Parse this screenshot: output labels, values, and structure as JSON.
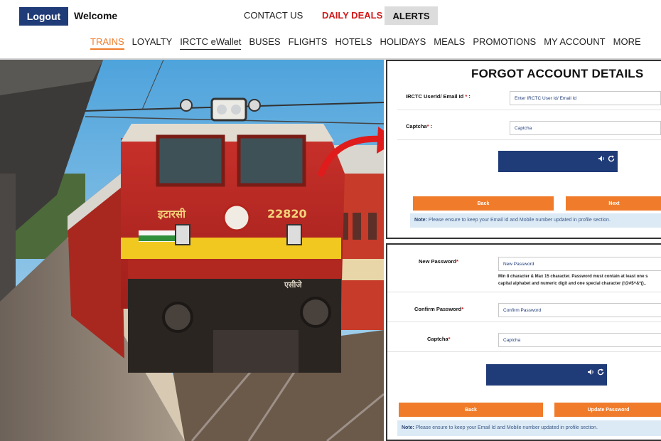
{
  "header": {
    "logout_label": "Logout",
    "welcome": "Welcome",
    "contact_us": "CONTACT US",
    "daily_deals": "DAILY DEALS",
    "alerts": "ALERTS"
  },
  "nav": {
    "items": [
      "TRAINS",
      "LOYALTY",
      "IRCTC eWallet",
      "BUSES",
      "FLIGHTS",
      "HOTELS",
      "HOLIDAYS",
      "MEALS",
      "PROMOTIONS",
      "MY ACCOUNT",
      "MORE"
    ]
  },
  "photo": {
    "engine_name": "इटारसी",
    "engine_number": "22820",
    "nose_text": "एसीजे"
  },
  "forgot_form": {
    "title": "FORGOT ACCOUNT DETAILS",
    "userid_label": "IRCTC UserId/ Email Id",
    "userid_placeholder": "Enter IRCTC User Id/ Email Id",
    "captcha_label": "Captcha",
    "captcha_placeholder": "Captcha",
    "back_label": "Back",
    "next_label": "Next",
    "note_prefix": "Note:",
    "note_text": "Please ensure to keep your Email Id and Mobile number updated in profile section."
  },
  "reset_form": {
    "new_password_label": "New Password",
    "new_password_placeholder": "New Password",
    "password_hint_line1": "Min 8 character & Max 15 character. Password must contain at least one s",
    "password_hint_line2": "capital alphabet and numeric digit and one special character (!@#$^&*()..",
    "confirm_password_label": "Confirm Password",
    "confirm_password_placeholder": "Confirm Password",
    "captcha_label": "Captcha",
    "captcha_placeholder": "Captcha",
    "back_label": "Back",
    "update_label": "Update Password",
    "note_prefix": "Note:",
    "note_text": "Please ensure to keep your Email Id and Mobile number updated in profile section."
  },
  "colors": {
    "brand_blue": "#1f3b78",
    "accent_orange": "#f07c2b",
    "deals_red": "#d11a1a",
    "note_bg": "#dceaf6"
  }
}
